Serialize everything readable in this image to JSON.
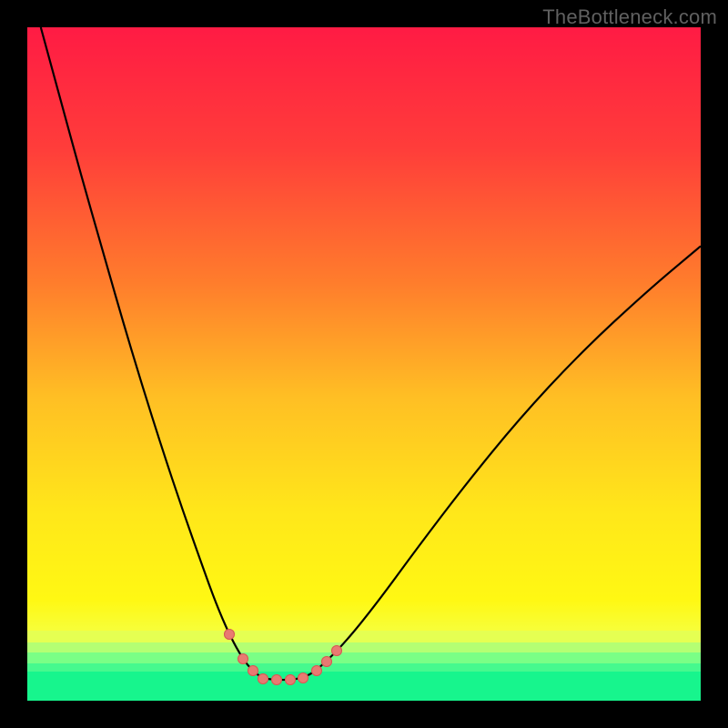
{
  "watermark": {
    "text": "TheBottleneck.com"
  },
  "colors": {
    "frame": "#000000",
    "gradient_stops": [
      {
        "pos": 0.0,
        "color": "#ff1b44"
      },
      {
        "pos": 0.18,
        "color": "#ff3d3a"
      },
      {
        "pos": 0.38,
        "color": "#ff7d2c"
      },
      {
        "pos": 0.55,
        "color": "#ffbf24"
      },
      {
        "pos": 0.72,
        "color": "#ffe71a"
      },
      {
        "pos": 0.85,
        "color": "#fff813"
      },
      {
        "pos": 0.9,
        "color": "#f6ff3d"
      },
      {
        "pos": 0.93,
        "color": "#d8ff5e"
      },
      {
        "pos": 0.955,
        "color": "#a4ff7a"
      },
      {
        "pos": 0.975,
        "color": "#5cff8f"
      },
      {
        "pos": 1.0,
        "color": "#17f58d"
      }
    ],
    "green_bands": [
      {
        "top_pct": 95.5,
        "height_pct": 4.5,
        "color": "#17f58d"
      },
      {
        "top_pct": 94.2,
        "height_pct": 1.5,
        "color": "#46f98e"
      },
      {
        "top_pct": 92.8,
        "height_pct": 1.6,
        "color": "#7aff86"
      },
      {
        "top_pct": 91.3,
        "height_pct": 1.6,
        "color": "#b4ff73"
      },
      {
        "top_pct": 89.6,
        "height_pct": 1.8,
        "color": "#e5ff52"
      }
    ],
    "curve": "#000000",
    "marker_fill": "#e87a72",
    "marker_stroke": "#d55a52"
  },
  "chart_data": {
    "type": "line",
    "title": "",
    "xlabel": "",
    "ylabel": "",
    "watermark": "TheBottleneck.com",
    "xlim": [
      0,
      100
    ],
    "ylim": [
      0,
      100
    ],
    "series": [
      {
        "name": "bottleneck-curve",
        "x": [
          2,
          5,
          8,
          11,
          14,
          17,
          20,
          23,
          26,
          28,
          30,
          32,
          33.5,
          35,
          37,
          39,
          41,
          43,
          47,
          52,
          58,
          65,
          73,
          82,
          92,
          100
        ],
        "y": [
          100,
          89,
          78,
          67.5,
          57,
          47,
          37.5,
          28.5,
          20,
          14.5,
          9.8,
          6.2,
          4.4,
          3.3,
          3.1,
          3.1,
          3.4,
          4.5,
          8.4,
          14.6,
          22.8,
          32,
          41.8,
          51.5,
          60.8,
          67.5
        ]
      }
    ],
    "markers": [
      {
        "x": 30.0,
        "y": 9.8
      },
      {
        "x": 32.0,
        "y": 6.2
      },
      {
        "x": 33.5,
        "y": 4.4
      },
      {
        "x": 35.0,
        "y": 3.3
      },
      {
        "x": 37.0,
        "y": 3.1
      },
      {
        "x": 39.0,
        "y": 3.1
      },
      {
        "x": 41.0,
        "y": 3.4
      },
      {
        "x": 43.0,
        "y": 4.5
      },
      {
        "x": 44.5,
        "y": 5.8
      },
      {
        "x": 46.0,
        "y": 7.4
      }
    ]
  }
}
